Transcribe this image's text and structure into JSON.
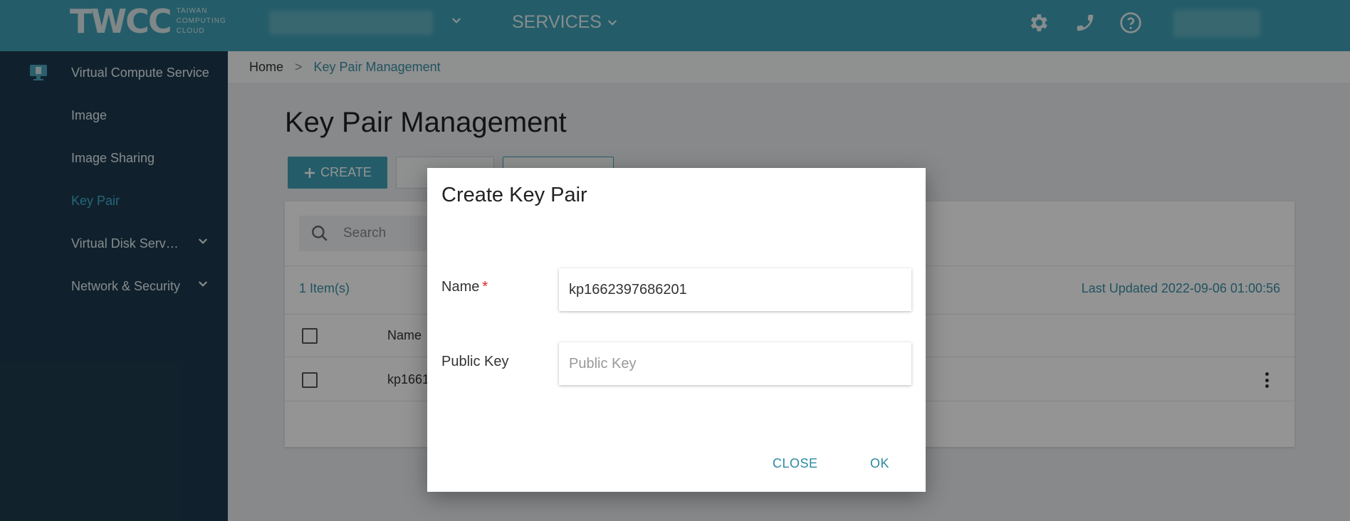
{
  "header": {
    "logo_text": "TWCC",
    "logo_sub_lines": [
      "TAIWAN",
      "COMPUTING",
      "CLOUD"
    ],
    "services_label": "SERVICES"
  },
  "sidebar": {
    "items": [
      {
        "label": "Virtual Compute Service",
        "active": false
      },
      {
        "label": "Image",
        "active": false
      },
      {
        "label": "Image Sharing",
        "active": false
      },
      {
        "label": "Key Pair",
        "active": true
      },
      {
        "label": "Virtual Disk Serv…",
        "active": false,
        "expandable": true
      },
      {
        "label": "Network & Security",
        "active": false,
        "expandable": true
      }
    ]
  },
  "breadcrumb": {
    "home": "Home",
    "separator": ">",
    "current": "Key Pair Management"
  },
  "page": {
    "title": "Key Pair Management",
    "create_button": "CREATE",
    "search_placeholder": "Search",
    "item_count": "1 Item(s)",
    "last_updated": "Last Updated 2022-09-06 01:00:56",
    "table": {
      "header_name": "Name",
      "rows": [
        {
          "name": "kp1661"
        }
      ]
    }
  },
  "dialog": {
    "title": "Create Key Pair",
    "name_label": "Name",
    "name_required_mark": "*",
    "name_value": "kp1662397686201",
    "public_key_label": "Public Key",
    "public_key_placeholder": "Public Key",
    "close_label": "CLOSE",
    "ok_label": "OK"
  },
  "colors": {
    "topbar": "#3fa1b5",
    "sidebar": "#1d3a4e",
    "accent": "#3a8fa6",
    "active_sidebar": "#3fb0d0"
  }
}
